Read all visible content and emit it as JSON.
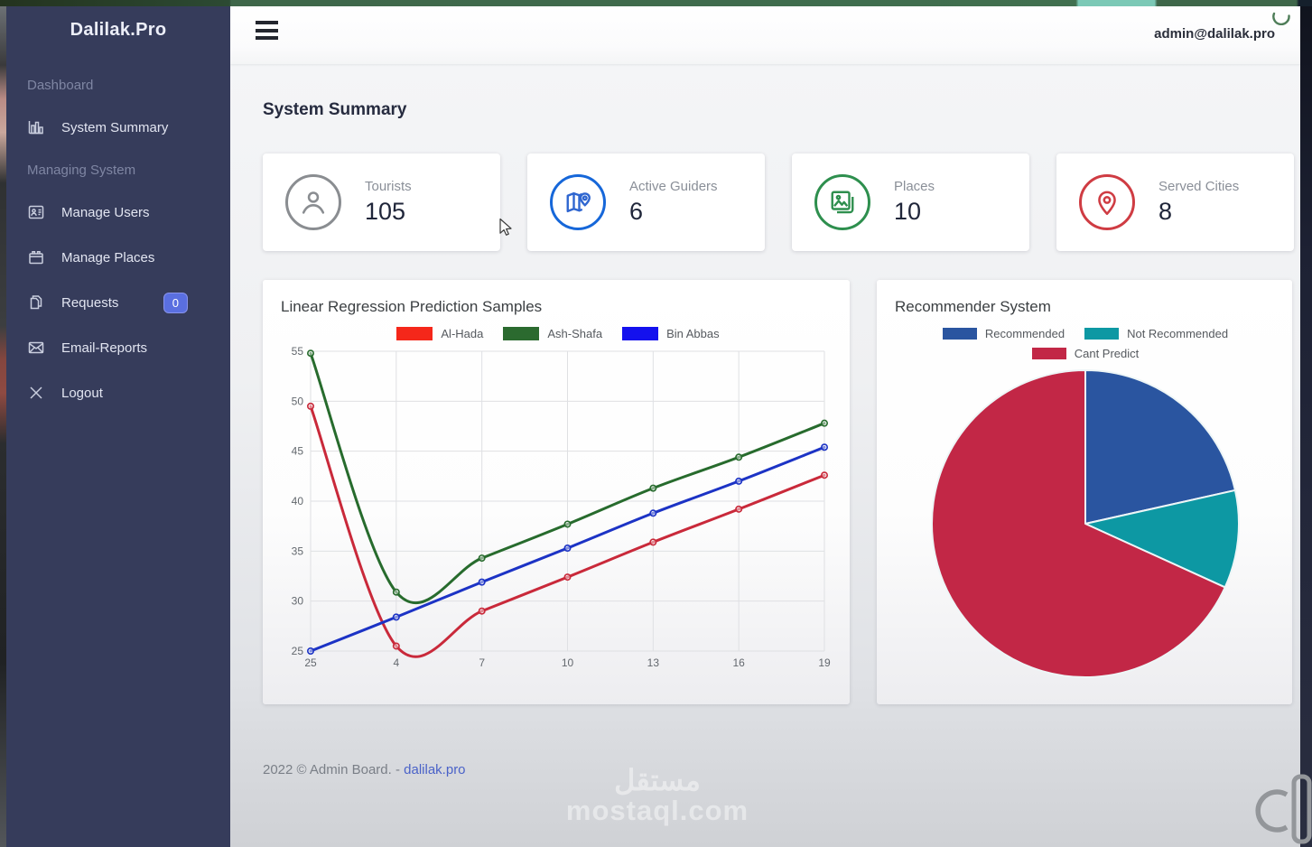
{
  "topbar": {
    "email": "admin@dalilak.pro"
  },
  "sidebar": {
    "brand": "Dalilak.Pro",
    "section_dashboard": "Dashboard",
    "item_system_summary": "System Summary",
    "section_managing": "Managing System",
    "item_manage_users": "Manage Users",
    "item_manage_places": "Manage Places",
    "item_requests": "Requests",
    "requests_badge": "0",
    "item_email_reports": "Email-Reports",
    "item_logout": "Logout"
  },
  "page": {
    "title": "System Summary"
  },
  "stats": {
    "tourists": {
      "label": "Tourists",
      "value": "105",
      "color": "#8a8d91",
      "icon": "person-icon"
    },
    "guiders": {
      "label": "Active Guiders",
      "value": "6",
      "color": "#1667d9",
      "icon": "map-icon"
    },
    "places": {
      "label": "Places",
      "value": "10",
      "color": "#2e8f4e",
      "icon": "images-icon"
    },
    "cities": {
      "label": "Served Cities",
      "value": "8",
      "color": "#cf3c43",
      "icon": "pin-icon"
    }
  },
  "chart_data": [
    {
      "type": "line",
      "title": "Linear Regression Prediction Samples",
      "categories": [
        "25",
        "4",
        "7",
        "10",
        "13",
        "16",
        "19"
      ],
      "ylim": [
        25,
        55
      ],
      "ytick_step": 5,
      "grid": true,
      "legend_position": "top",
      "series": [
        {
          "name": "Al-Hada",
          "swatch": "#f5271a",
          "color": "#c9293a",
          "values": [
            49.5,
            25.5,
            29.0,
            32.4,
            35.9,
            39.2,
            42.6
          ]
        },
        {
          "name": "Ash-Shafa",
          "swatch": "#2b6a2f",
          "color": "#276b2d",
          "values": [
            54.8,
            30.9,
            34.3,
            37.7,
            41.3,
            44.4,
            47.8
          ]
        },
        {
          "name": "Bin Abbas",
          "swatch": "#1411ee",
          "color": "#1c33c5",
          "values": [
            25.0,
            28.4,
            31.9,
            35.3,
            38.8,
            42.0,
            45.4
          ]
        }
      ]
    },
    {
      "type": "pie",
      "title": "Recommender System",
      "legend_position": "top",
      "slices": [
        {
          "label": "Recommended",
          "value": 21.5,
          "color": "#2a55a0"
        },
        {
          "label": "Not Recommended",
          "value": 10.3,
          "color": "#0d98a3"
        },
        {
          "label": "Cant Predict",
          "value": 68.2,
          "color": "#c22746"
        }
      ]
    }
  ],
  "footer": {
    "text": "2022 © Admin Board. -",
    "link": "dalilak.pro"
  },
  "watermark": {
    "arabic": "مستقل",
    "domain": "mostaql.com"
  }
}
